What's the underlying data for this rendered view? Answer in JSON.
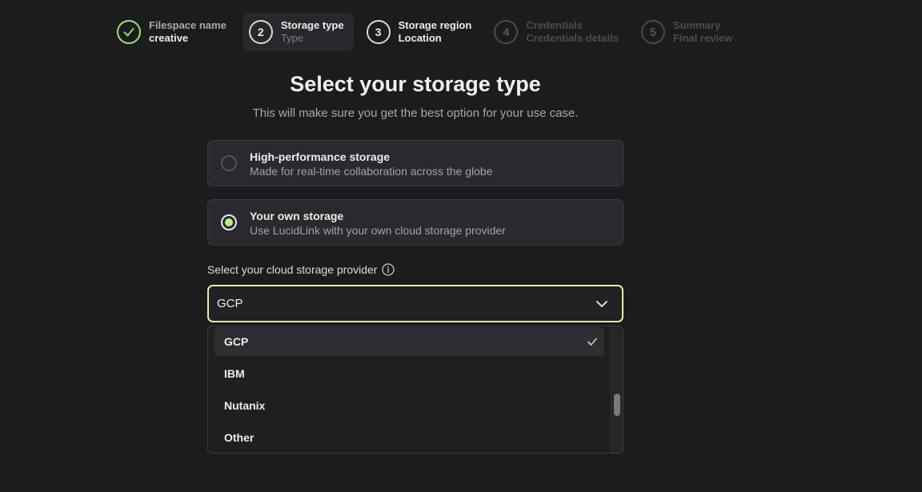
{
  "stepper": {
    "steps": [
      {
        "number": "",
        "title": "Filespace name",
        "subtitle": "creative",
        "state": "done"
      },
      {
        "number": "2",
        "title": "Storage type",
        "subtitle": "Type",
        "state": "active"
      },
      {
        "number": "3",
        "title": "Storage region",
        "subtitle": "Location",
        "state": "upcoming"
      },
      {
        "number": "4",
        "title": "Credentials",
        "subtitle": "Credentials details",
        "state": "disabled"
      },
      {
        "number": "5",
        "title": "Summary",
        "subtitle": "Final review",
        "state": "disabled"
      }
    ]
  },
  "heading": {
    "title": "Select your storage type",
    "subtitle": "This will make sure you get the best option for your use case."
  },
  "options": [
    {
      "title": "High-performance storage",
      "description": "Made for real-time collaboration across the globe",
      "selected": false
    },
    {
      "title": "Your own storage",
      "description": "Use LucidLink with your own cloud storage provider",
      "selected": true
    }
  ],
  "provider": {
    "label": "Select your cloud storage provider",
    "selected_value": "GCP",
    "dropdown_items": [
      {
        "label": "GCP",
        "selected": true
      },
      {
        "label": "IBM",
        "selected": false
      },
      {
        "label": "Nutanix",
        "selected": false
      },
      {
        "label": "Other",
        "selected": false
      }
    ]
  },
  "colors": {
    "accent": "#b8f08a",
    "focus_border": "#d8f5a8",
    "done_ring": "#9be37a",
    "background": "#1c1c1e"
  },
  "icons": {
    "done_step": "check-icon",
    "info": "info-icon",
    "select": "chevron-down-icon",
    "selected_item": "check-icon"
  }
}
